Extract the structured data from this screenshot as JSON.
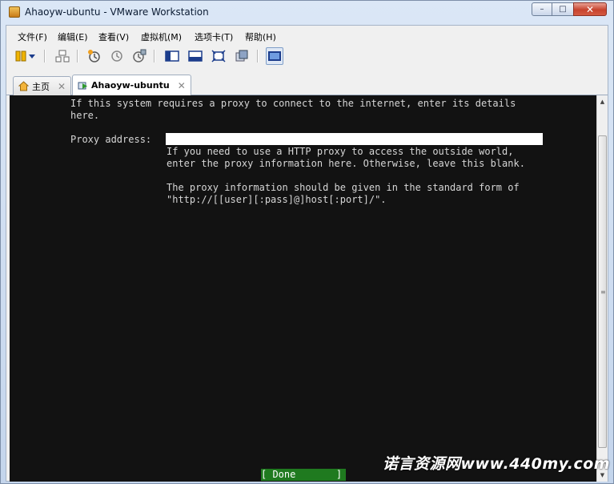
{
  "window": {
    "title": "Ahaoyw-ubuntu - VMware Workstation",
    "buttons": {
      "minimize": "–",
      "maximize": "□",
      "close": "✕"
    }
  },
  "menubar": {
    "items": [
      "文件(F)",
      "编辑(E)",
      "查看(V)",
      "虚拟机(M)",
      "选项卡(T)",
      "帮助(H)"
    ]
  },
  "toolbar": {
    "icons": [
      "pause-icon",
      "dropdown-arrow-icon",
      "send-keys-icon",
      "snapshot-icon",
      "revert-snapshot-icon",
      "snapshot-manager-icon",
      "show-library-icon",
      "thumbnail-bar-icon",
      "fullscreen-icon",
      "unity-icon",
      "console-view-icon"
    ]
  },
  "tabs": [
    {
      "label": "主页",
      "close": "✕",
      "icon": "home-icon"
    },
    {
      "label": "Ahaoyw-ubuntu",
      "close": "✕",
      "icon": "vm-icon"
    }
  ],
  "vm_console": {
    "intro_line1": "If this system requires a proxy to connect to the internet, enter its details",
    "intro_line2": "here.",
    "proxy_label": "Proxy address:",
    "proxy_value": "",
    "help_line1": "If you need to use a HTTP proxy to access the outside world,",
    "help_line2": "enter the proxy information here. Otherwise, leave this blank.",
    "help_line3": "The proxy information should be given in the standard form of",
    "help_line4": "\"http://[[user][:pass]@]host[:port]/\".",
    "done_label": "[ Done       ]"
  },
  "scrollbar": {
    "up": "▲",
    "down": "▼",
    "grip": "≡"
  },
  "watermark": "诺言资源网www.440my.com"
}
